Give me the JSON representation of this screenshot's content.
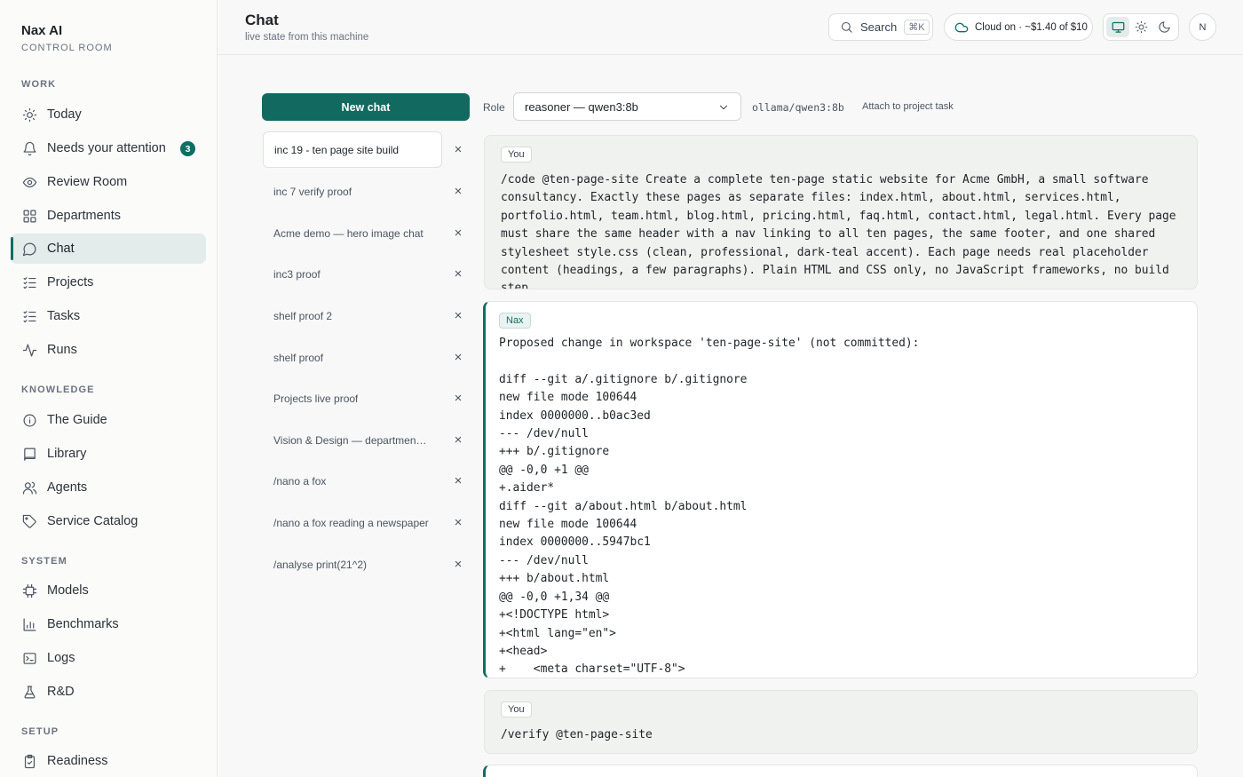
{
  "brand": {
    "name": "Nax AI",
    "subtitle": "CONTROL ROOM"
  },
  "sidebar": {
    "sections": [
      {
        "label": "WORK",
        "items": [
          {
            "label": "Today",
            "icon": "sun-icon"
          },
          {
            "label": "Needs your attention",
            "icon": "bell-icon",
            "badge": "3"
          },
          {
            "label": "Review Room",
            "icon": "eye-icon"
          },
          {
            "label": "Departments",
            "icon": "grid-icon"
          },
          {
            "label": "Chat",
            "icon": "chat-icon",
            "active": true
          },
          {
            "label": "Projects",
            "icon": "list-check-icon"
          },
          {
            "label": "Tasks",
            "icon": "list-check-icon"
          },
          {
            "label": "Runs",
            "icon": "activity-icon"
          }
        ]
      },
      {
        "label": "KNOWLEDGE",
        "items": [
          {
            "label": "The Guide",
            "icon": "info-icon"
          },
          {
            "label": "Library",
            "icon": "book-icon"
          },
          {
            "label": "Agents",
            "icon": "users-icon"
          },
          {
            "label": "Service Catalog",
            "icon": "tag-icon"
          }
        ]
      },
      {
        "label": "SYSTEM",
        "items": [
          {
            "label": "Models",
            "icon": "chip-icon"
          },
          {
            "label": "Benchmarks",
            "icon": "bar-chart-icon"
          },
          {
            "label": "Logs",
            "icon": "terminal-icon"
          },
          {
            "label": "R&D",
            "icon": "flask-icon"
          }
        ]
      },
      {
        "label": "SETUP",
        "items": [
          {
            "label": "Readiness",
            "icon": "clipboard-check-icon"
          }
        ]
      }
    ]
  },
  "header": {
    "title": "Chat",
    "subtitle": "live state from this machine",
    "search_label": "Search",
    "search_shortcut": "⌘K",
    "cloud_status": "Cloud on · ~$1.40 of $10",
    "avatar_initial": "N"
  },
  "chat_list": {
    "new_chat_label": "New chat",
    "items": [
      {
        "title": "inc 19 - ten page site build",
        "selected": true
      },
      {
        "title": "inc 7 verify proof"
      },
      {
        "title": "Acme demo — hero image chat"
      },
      {
        "title": "inc3 proof"
      },
      {
        "title": "shelf proof 2"
      },
      {
        "title": "shelf proof"
      },
      {
        "title": "Projects live proof"
      },
      {
        "title": "Vision & Design — department ..."
      },
      {
        "title": "/nano a fox"
      },
      {
        "title": "/nano a fox reading a newspaper"
      },
      {
        "title": "/analyse print(21^2)"
      }
    ]
  },
  "role_bar": {
    "role_label": "Role",
    "role_value": "reasoner — qwen3:8b",
    "model_id": "ollama/qwen3:8b",
    "attach_label": "Attach to project task"
  },
  "messages": [
    {
      "sender": "You",
      "text": "/code @ten-page-site Create a complete ten-page static website for Acme GmbH, a small software consultancy. Exactly these pages as separate files: index.html, about.html, services.html, portfolio.html, team.html, blog.html, pricing.html, faq.html, contact.html, legal.html. Every page must share the same header with a nav linking to all ten pages, the same footer, and one shared stylesheet style.css (clean, professional, dark-teal accent). Each page needs real placeholder content (headings, a few paragraphs). Plain HTML and CSS only, no JavaScript frameworks, no build step."
    },
    {
      "sender": "Nax",
      "text": "Proposed change in workspace 'ten-page-site' (not committed):\n\ndiff --git a/.gitignore b/.gitignore\nnew file mode 100644\nindex 0000000..b0ac3ed\n--- /dev/null\n+++ b/.gitignore\n@@ -0,0 +1 @@\n+.aider*\ndiff --git a/about.html b/about.html\nnew file mode 100644\nindex 0000000..5947bc1\n--- /dev/null\n+++ b/about.html\n@@ -0,0 +1,34 @@\n+<!DOCTYPE html>\n+<html lang=\"en\">\n+<head>\n+    <meta charset=\"UTF-8\">"
    },
    {
      "sender": "You",
      "text": "/verify @ten-page-site"
    }
  ],
  "colors": {
    "accent": "#0f6e64",
    "accent_light": "#e3ecea"
  }
}
